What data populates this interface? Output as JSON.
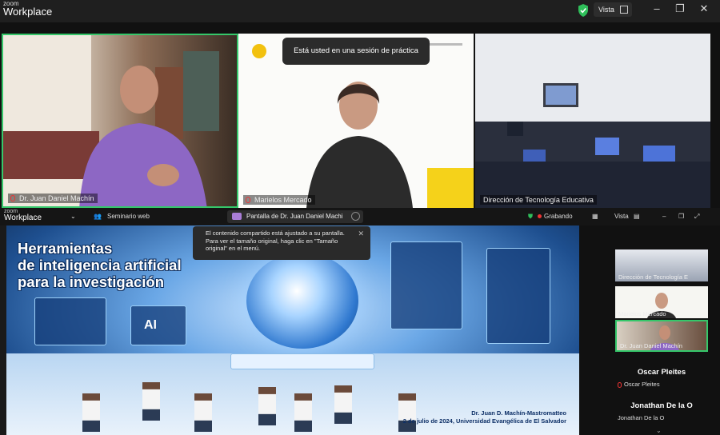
{
  "app": {
    "logo_small": "zoom",
    "logo_big": "Workplace"
  },
  "titlebar": {
    "view_label": "Vista"
  },
  "practice_banner": "Está usted en una sesión de práctica",
  "gallery": [
    {
      "name": "Dr. Juan Daniel Machín"
    },
    {
      "name": "Marielos Mercado"
    },
    {
      "name": "Dirección de Tecnología Educativa"
    }
  ],
  "bar2": {
    "logo_small": "zoom",
    "logo_big": "Workplace",
    "webinar_label": "Seminario web",
    "share_label": "Pantalla de Dr. Juan Daniel Machi",
    "recording_label": "Grabando",
    "view_label": "Vista"
  },
  "slide": {
    "title_line1": "Herramientas",
    "title_line2": "de inteligencia artificial",
    "title_line3": "para la investigación",
    "author_line1": "Dr. Juan D. Machín-Mastromatteo",
    "author_line2": "2 de julio de 2024, Universidad Evangélica de El Salvador",
    "panel_label": "AI"
  },
  "notice": {
    "text": "El contenido compartido está ajustado a su pantalla. Para ver el tamaño original, haga clic en \"Tamaño original\" en el menú."
  },
  "sidebar": {
    "thumbs": [
      {
        "name": "Dirección de Tecnología E"
      },
      {
        "name": "Marielos Mercado"
      },
      {
        "name": "Dr. Juan Daniel Machín"
      }
    ],
    "participants": [
      {
        "name": "Oscar Pleites",
        "sub": "Oscar Pleites"
      },
      {
        "name": "Jonathan De la O",
        "sub": "Jonathan De la O"
      }
    ]
  },
  "colors": {
    "active_speaker": "#35c76a",
    "recording": "#e33333",
    "share_icon": "#a97dd7"
  }
}
